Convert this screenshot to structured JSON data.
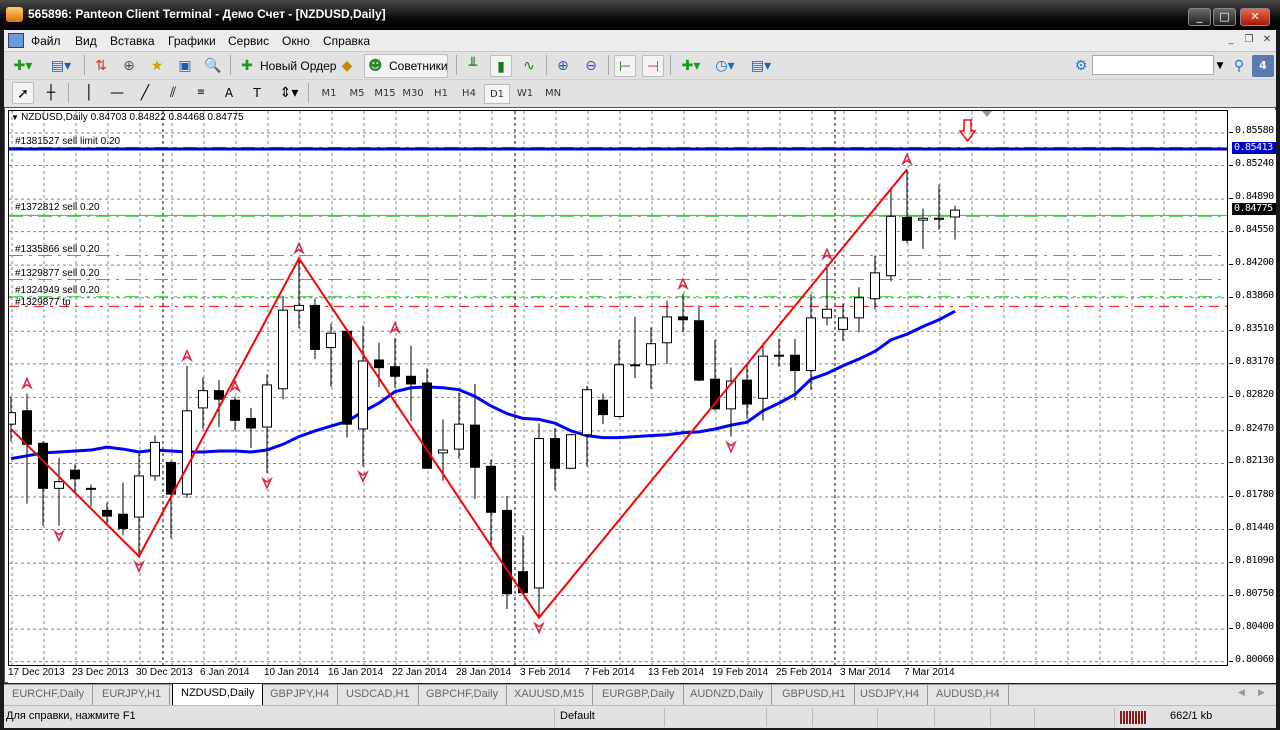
{
  "window": {
    "title": "565896: Panteon Client Terminal - Демо Счет - [NZDUSD,Daily]"
  },
  "menu": [
    "Файл",
    "Вид",
    "Вставка",
    "Графики",
    "Сервис",
    "Окно",
    "Справка"
  ],
  "toolbar": {
    "new_order": "Новый Ордер",
    "experts": "Советники",
    "search_placeholder": "",
    "notification_count": "4"
  },
  "timeframes": [
    "M1",
    "M5",
    "M15",
    "M30",
    "H1",
    "H4",
    "D1",
    "W1",
    "MN"
  ],
  "active_timeframe": "D1",
  "chart": {
    "legend": "NZDUSD,Daily  0.84703 0.84822 0.84468 0.84775",
    "current_price": "0.84775",
    "sell_limit_price": "0.85413",
    "orders": [
      {
        "label": "#1381527 sell limit 0.20",
        "price": 0.85413,
        "type": "sell-limit"
      },
      {
        "label": "#1372812 sell 0.20",
        "price": 0.8472,
        "type": "sell"
      },
      {
        "label": "#1335866 sell 0.20",
        "price": 0.8429,
        "type": "sell"
      },
      {
        "label": "#1329877 sell 0.20",
        "price": 0.8404,
        "type": "sell"
      },
      {
        "label": "#1324949 sell 0.20",
        "price": 0.8386,
        "type": "sell"
      },
      {
        "label": "#1329877 tp",
        "price": 0.8377,
        "type": "tp"
      }
    ],
    "green_levels": [
      0.8542,
      0.847,
      0.8429,
      0.8404,
      0.8386
    ],
    "colors": {
      "ma": "#0000ff",
      "zigzag": "#ff0000",
      "sell_limit": "#0000cc",
      "levels": "#22cc22",
      "tp": "#ff0000",
      "fractal": "#dd2244"
    }
  },
  "chart_data": {
    "type": "candlestick",
    "symbol": "NZDUSD",
    "timeframe": "Daily",
    "ylim": [
      0.8006,
      0.8558
    ],
    "price_ticks": [
      "0.85580",
      "0.85240",
      "0.84890",
      "0.84550",
      "0.84200",
      "0.83860",
      "0.83510",
      "0.83170",
      "0.82820",
      "0.82470",
      "0.82130",
      "0.81780",
      "0.81440",
      "0.81090",
      "0.80750",
      "0.80400",
      "0.80060"
    ],
    "time_ticks": [
      {
        "index": 0,
        "label": "17 Dec 2013"
      },
      {
        "index": 4,
        "label": "23 Dec 2013"
      },
      {
        "index": 8,
        "label": "30 Dec 2013"
      },
      {
        "index": 12,
        "label": "6 Jan 2014"
      },
      {
        "index": 16,
        "label": "10 Jan 2014"
      },
      {
        "index": 20,
        "label": "16 Jan 2014"
      },
      {
        "index": 24,
        "label": "22 Jan 2014"
      },
      {
        "index": 28,
        "label": "28 Jan 2014"
      },
      {
        "index": 32,
        "label": "3 Feb 2014"
      },
      {
        "index": 36,
        "label": "7 Feb 2014"
      },
      {
        "index": 40,
        "label": "13 Feb 2014"
      },
      {
        "index": 44,
        "label": "19 Feb 2014"
      },
      {
        "index": 48,
        "label": "25 Feb 2014"
      },
      {
        "index": 52,
        "label": "3 Mar 2014"
      },
      {
        "index": 56,
        "label": "7 Mar 2014"
      }
    ],
    "period_separators": [
      10,
      32,
      52
    ],
    "ohlc": [
      [
        0.8254,
        0.8283,
        0.8236,
        0.8266
      ],
      [
        0.8268,
        0.8286,
        0.8171,
        0.8233
      ],
      [
        0.8234,
        0.8236,
        0.8148,
        0.8187
      ],
      [
        0.8187,
        0.8219,
        0.8148,
        0.8194
      ],
      [
        0.8206,
        0.8212,
        0.8184,
        0.8197
      ],
      [
        0.8187,
        0.8191,
        0.8168,
        0.8186
      ],
      [
        0.8164,
        0.8172,
        0.8148,
        0.8158
      ],
      [
        0.816,
        0.8193,
        0.8138,
        0.8145
      ],
      [
        0.8157,
        0.8223,
        0.8116,
        0.82
      ],
      [
        0.82,
        0.8242,
        0.8195,
        0.8235
      ],
      [
        0.8214,
        0.8216,
        0.8135,
        0.8181
      ],
      [
        0.8181,
        0.8315,
        0.8177,
        0.8268
      ],
      [
        0.8271,
        0.8303,
        0.8249,
        0.8289
      ],
      [
        0.8289,
        0.83,
        0.8251,
        0.828
      ],
      [
        0.8279,
        0.8283,
        0.8248,
        0.8258
      ],
      [
        0.826,
        0.8271,
        0.8229,
        0.825
      ],
      [
        0.8251,
        0.8306,
        0.8203,
        0.8295
      ],
      [
        0.8291,
        0.8387,
        0.828,
        0.8373
      ],
      [
        0.8373,
        0.8427,
        0.8354,
        0.8378
      ],
      [
        0.8378,
        0.8385,
        0.8322,
        0.8332
      ],
      [
        0.8334,
        0.8359,
        0.8293,
        0.8349
      ],
      [
        0.8351,
        0.8352,
        0.824,
        0.8254
      ],
      [
        0.8249,
        0.8357,
        0.821,
        0.832
      ],
      [
        0.8321,
        0.8339,
        0.8293,
        0.8313
      ],
      [
        0.8314,
        0.8344,
        0.8292,
        0.8304
      ],
      [
        0.8304,
        0.8336,
        0.8257,
        0.8296
      ],
      [
        0.8297,
        0.8312,
        0.8208,
        0.8208
      ],
      [
        0.8224,
        0.8259,
        0.8195,
        0.8227
      ],
      [
        0.8228,
        0.8287,
        0.8218,
        0.8254
      ],
      [
        0.8253,
        0.8296,
        0.8176,
        0.8209
      ],
      [
        0.821,
        0.8217,
        0.8125,
        0.8162
      ],
      [
        0.8164,
        0.8179,
        0.8061,
        0.8077
      ],
      [
        0.81,
        0.8138,
        0.8078,
        0.8078
      ],
      [
        0.8083,
        0.8255,
        0.8052,
        0.8239
      ],
      [
        0.8239,
        0.825,
        0.8185,
        0.8208
      ],
      [
        0.8208,
        0.8244,
        0.8207,
        0.8243
      ],
      [
        0.8243,
        0.8294,
        0.821,
        0.829
      ],
      [
        0.8279,
        0.8286,
        0.8254,
        0.8264
      ],
      [
        0.8262,
        0.8342,
        0.8261,
        0.8316
      ],
      [
        0.8316,
        0.8366,
        0.8302,
        0.8315
      ],
      [
        0.8316,
        0.8355,
        0.8291,
        0.8338
      ],
      [
        0.8339,
        0.8383,
        0.8317,
        0.8366
      ],
      [
        0.8366,
        0.839,
        0.835,
        0.8363
      ],
      [
        0.8362,
        0.8378,
        0.8299,
        0.83
      ],
      [
        0.8301,
        0.8342,
        0.8268,
        0.827
      ],
      [
        0.827,
        0.8313,
        0.8241,
        0.8299
      ],
      [
        0.83,
        0.8318,
        0.826,
        0.8275
      ],
      [
        0.8281,
        0.8339,
        0.8258,
        0.8325
      ],
      [
        0.8325,
        0.8343,
        0.8314,
        0.8326
      ],
      [
        0.8326,
        0.8343,
        0.8279,
        0.831
      ],
      [
        0.831,
        0.839,
        0.829,
        0.8365
      ],
      [
        0.8365,
        0.8421,
        0.8357,
        0.8374
      ],
      [
        0.8353,
        0.838,
        0.8341,
        0.8365
      ],
      [
        0.8365,
        0.8397,
        0.835,
        0.8386
      ],
      [
        0.8385,
        0.843,
        0.8374,
        0.8412
      ],
      [
        0.8409,
        0.85,
        0.8403,
        0.8471
      ],
      [
        0.847,
        0.852,
        0.8443,
        0.8446
      ],
      [
        0.8467,
        0.8479,
        0.8437,
        0.8469
      ],
      [
        0.8469,
        0.8504,
        0.8457,
        0.8468
      ],
      [
        0.84703,
        0.84822,
        0.84468,
        0.84775
      ]
    ],
    "moving_average": [
      0.8218,
      0.8221,
      0.8224,
      0.8225,
      0.8226,
      0.8227,
      0.823,
      0.8228,
      0.8225,
      0.8227,
      0.8226,
      0.8225,
      0.8225,
      0.8226,
      0.8226,
      0.8225,
      0.8227,
      0.8233,
      0.8241,
      0.8247,
      0.8252,
      0.8257,
      0.8267,
      0.8276,
      0.8288,
      0.8292,
      0.8293,
      0.8292,
      0.829,
      0.8283,
      0.8273,
      0.8265,
      0.826,
      0.8259,
      0.8255,
      0.8247,
      0.8242,
      0.824,
      0.824,
      0.8241,
      0.8242,
      0.8243,
      0.8245,
      0.8246,
      0.8249,
      0.8253,
      0.8256,
      0.8268,
      0.8276,
      0.8285,
      0.8301,
      0.8307,
      0.8315,
      0.8322,
      0.833,
      0.8342,
      0.8348,
      0.8356,
      0.8363,
      0.8372
    ],
    "zigzag": [
      [
        0,
        0.8249
      ],
      [
        8,
        0.8116
      ],
      [
        18,
        0.8427
      ],
      [
        33,
        0.8052
      ],
      [
        56,
        0.852
      ]
    ],
    "fractals_up": [
      1,
      11,
      14,
      18,
      24,
      42,
      51,
      56
    ],
    "fractals_down": [
      3,
      8,
      16,
      22,
      33,
      45
    ]
  },
  "tabs": [
    "EURCHF,Daily",
    "EURJPY,H1",
    "NZDUSD,Daily",
    "GBPJPY,H4",
    "USDCAD,H1",
    "GBPCHF,Daily",
    "XAUUSD,M15",
    "EURGBP,Daily",
    "AUDNZD,Daily",
    "GBPUSD,H1",
    "USDJPY,H4",
    "AUDUSD,H4"
  ],
  "active_tab": "NZDUSD,Daily",
  "status": {
    "help": "Для справки, нажмите F1",
    "profile": "Default",
    "traffic": "662/1 kb"
  }
}
